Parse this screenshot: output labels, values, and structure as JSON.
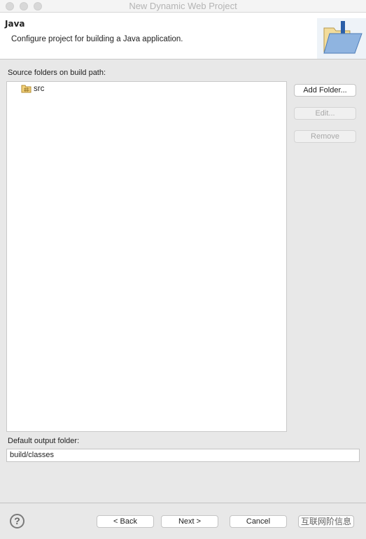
{
  "window": {
    "title": "New Dynamic Web Project"
  },
  "header": {
    "title": "Java",
    "description": "Configure project for building a Java application."
  },
  "source": {
    "label": "Source folders on build path:",
    "items": [
      {
        "label": "src",
        "icon": "source-folder-icon"
      }
    ]
  },
  "side_buttons": {
    "add": "Add Folder...",
    "edit": "Edit...",
    "remove": "Remove"
  },
  "output": {
    "label": "Default output folder:",
    "value": "build/classes"
  },
  "footer": {
    "help": "?",
    "back": "< Back",
    "next": "Next >",
    "cancel": "Cancel",
    "watermark": "互联网阶信息"
  }
}
